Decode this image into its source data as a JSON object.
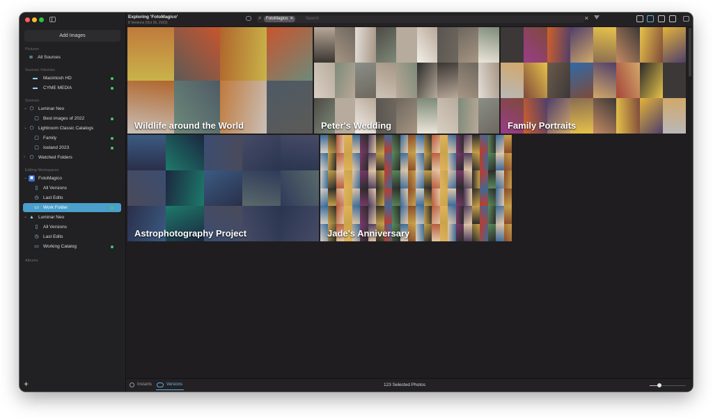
{
  "window": {
    "title": "Exploring 'FotoMagico'",
    "subtitle": "8 Versions (Oct 26, 2023)"
  },
  "sidebar": {
    "add_button": "Add Images",
    "sections": {
      "pictures": "Pictures",
      "volumes": "Sources Volumes",
      "sources": "Sources",
      "workspaces": "Editing Workspaces",
      "albums": "Albums"
    },
    "items": [
      {
        "label": "All Sources",
        "icon": "layers-icon"
      },
      {
        "label": "Macintosh HD",
        "icon": "drive-icon",
        "status": "online"
      },
      {
        "label": "CYME MEDIA",
        "icon": "drive-icon",
        "status": "online"
      },
      {
        "label": "Luminar Neo",
        "icon": "source-icon"
      },
      {
        "label": "Best images of 2022",
        "icon": "album-icon",
        "status": "online"
      },
      {
        "label": "Lightroom Classic Catalogs",
        "icon": "source-icon"
      },
      {
        "label": "Family",
        "icon": "catalog-icon",
        "status": "online"
      },
      {
        "label": "Iceland 2023",
        "icon": "catalog-icon",
        "status": "online"
      },
      {
        "label": "Watched Folders",
        "icon": "source-icon"
      },
      {
        "label": "FotoMagico",
        "icon": "app-icon"
      },
      {
        "label": "All Versions",
        "icon": "doc-icon"
      },
      {
        "label": "Last Edits",
        "icon": "clock-icon"
      },
      {
        "label": "Work Folder",
        "icon": "folder-icon",
        "status": "online",
        "selected": true
      },
      {
        "label": "Luminar Neo",
        "icon": "triangle-icon"
      },
      {
        "label": "All Versions",
        "icon": "doc-icon"
      },
      {
        "label": "Last Edits",
        "icon": "clock-icon"
      },
      {
        "label": "Working Catalog",
        "icon": "folder-icon",
        "status": "online"
      }
    ]
  },
  "toolbar": {
    "search_chip": "FotoMagico",
    "search_placeholder": "Search",
    "view_buttons": [
      "list-view-icon",
      "grid-view-icon",
      "single-view-icon",
      "map-view-icon"
    ],
    "active_view": "grid-view-icon"
  },
  "albums": [
    {
      "title": "Wildlife around the World",
      "colors": [
        "#c9b34a",
        "#4e5a66",
        "#c07a3c",
        "#6d8a7a",
        "#c9c0b8",
        "#c8552e",
        "#b0662c",
        "#5c5a56"
      ]
    },
    {
      "title": "Peter's Wedding",
      "colors": [
        "#e3dfd9",
        "#3a3532",
        "#b8a898",
        "#8a8f87",
        "#d9cfc2",
        "#6e675e",
        "#f2efe9",
        "#4d4a45",
        "#a69583",
        "#2d2b29",
        "#cdc4b8",
        "#7d8a79",
        "#ede6da",
        "#595550",
        "#b7ab9d"
      ]
    },
    {
      "title": "Family Portraits",
      "colors": [
        "#8a6d52",
        "#d0602a",
        "#3c3838",
        "#a6443a",
        "#2f6aa8",
        "#7e4a3a",
        "#e3b23a",
        "#c48a62",
        "#4f3f6b",
        "#9a3c8a",
        "#2a2a2a",
        "#d2a86a",
        "#6b5a4a",
        "#b8b8b8",
        "#e7c24a"
      ]
    },
    {
      "title": "Astrophotography Project",
      "colors": [
        "#1d7a6a",
        "#2a3550",
        "#3b5b82",
        "#2a2f4a",
        "#474b66",
        "#1c2740",
        "#2e3a5a",
        "#3c4d70",
        "#4a4a5a",
        "#5a6a6a"
      ]
    },
    {
      "title": "Jade's Anniversary",
      "colors": [
        "#c23b2a",
        "#e0b35a",
        "#3a6a9a",
        "#7a3a6a",
        "#d8d0c4",
        "#2a2a2a",
        "#b85a3a",
        "#5a8a5a",
        "#e3c8a8",
        "#8a4a2a",
        "#4a3a5a",
        "#c9a24a"
      ]
    }
  ],
  "bottom_bar": {
    "instants_label": "Instants",
    "versions_label": "Versions",
    "selection_count": "123 Selected Photos",
    "zoom_level": 0.26
  }
}
